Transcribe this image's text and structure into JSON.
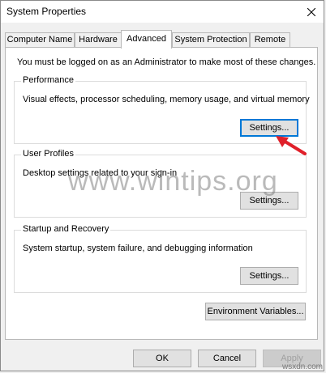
{
  "window": {
    "title": "System Properties"
  },
  "tabs": [
    {
      "label": "Computer Name",
      "active": false
    },
    {
      "label": "Hardware",
      "active": false
    },
    {
      "label": "Advanced",
      "active": true
    },
    {
      "label": "System Protection",
      "active": false
    },
    {
      "label": "Remote",
      "active": false
    }
  ],
  "admin_note": "You must be logged on as an Administrator to make most of these changes.",
  "groups": {
    "performance": {
      "title": "Performance",
      "desc": "Visual effects, processor scheduling, memory usage, and virtual memory",
      "button": "Settings..."
    },
    "user_profiles": {
      "title": "User Profiles",
      "desc": "Desktop settings related to your sign-in",
      "button": "Settings..."
    },
    "startup_recovery": {
      "title": "Startup and Recovery",
      "desc": "System startup, system failure, and debugging information",
      "button": "Settings..."
    }
  },
  "env_button": "Environment Variables...",
  "footer": {
    "ok": "OK",
    "cancel": "Cancel",
    "apply": "Apply"
  },
  "watermark": "www.wintips.org",
  "brand": "wsxdn.com",
  "colors": {
    "accent": "#0078d7",
    "arrow": "#e0202a"
  }
}
